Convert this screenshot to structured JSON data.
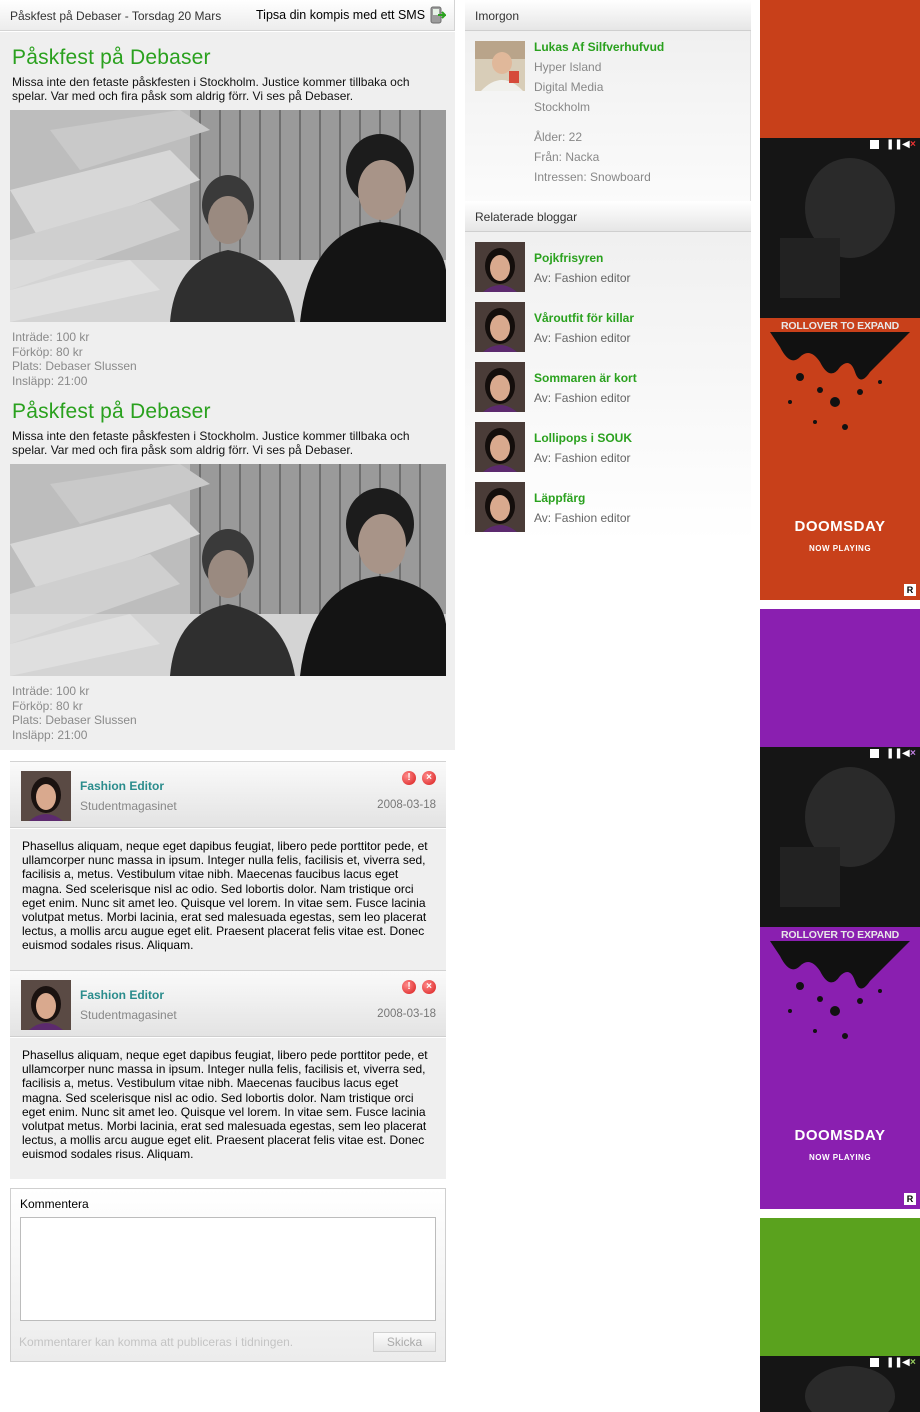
{
  "topbar": {
    "breadcrumb": "Påskfest på Debaser - Torsdag 20 Mars",
    "tip_link": "Tipsa din kompis med ett SMS",
    "tip_icon": "phone-sms-icon"
  },
  "events": [
    {
      "title": "Påskfest på Debaser",
      "description": "Missa inte den fetaste påskfesten i Stockholm. Justice kommer tillbaka och spelar. Var med och fira påsk som aldrig förr. Vi ses på Debaser.",
      "inträde": "Inträde: 100 kr",
      "förköp": "Förköp: 80 kr",
      "plats": "Plats: Debaser Slussen",
      "insläpp": "Insläpp: 21:00"
    },
    {
      "title": "Påskfest på Debaser",
      "description": "Missa inte den fetaste påskfesten i Stockholm. Justice kommer tillbaka och spelar. Var med och fira påsk som aldrig förr. Vi ses på Debaser.",
      "inträde": "Inträde: 100 kr",
      "förköp": "Förköp: 80 kr",
      "plats": "Plats: Debaser Slussen",
      "insläpp": "Insläpp: 21:00"
    }
  ],
  "comments": [
    {
      "author": "Fashion Editor",
      "org": "Studentmagasinet",
      "date": "2008-03-18",
      "body": "Phasellus aliquam, neque eget dapibus feugiat, libero pede porttitor pede, et ullamcorper nunc massa in ipsum. Integer nulla felis, facilisis et, viverra sed, facilisis a, metus. Vestibulum vitae nibh. Maecenas faucibus lacus eget magna. Sed scelerisque nisl ac odio. Sed lobortis dolor. Nam tristique orci eget enim. Nunc sit amet leo. Quisque vel lorem. In vitae sem. Fusce lacinia volutpat metus. Morbi lacinia, erat sed malesuada egestas, sem leo placerat lectus, a mollis arcu augue eget elit. Praesent placerat felis vitae est. Donec euismod sodales risus. Aliquam."
    },
    {
      "author": "Fashion Editor",
      "org": "Studentmagasinet",
      "date": "2008-03-18",
      "body": "Phasellus aliquam, neque eget dapibus feugiat, libero pede porttitor pede, et ullamcorper nunc massa in ipsum. Integer nulla felis, facilisis et, viverra sed, facilisis a, metus. Vestibulum vitae nibh. Maecenas faucibus lacus eget magna. Sed scelerisque nisl ac odio. Sed lobortis dolor. Nam tristique orci eget enim. Nunc sit amet leo. Quisque vel lorem. In vitae sem. Fusce lacinia volutpat metus. Morbi lacinia, erat sed malesuada egestas, sem leo placerat lectus, a mollis arcu augue eget elit. Praesent placerat felis vitae est. Donec euismod sodales risus. Aliquam."
    }
  ],
  "comment_form": {
    "label": "Kommentera",
    "note": "Kommentarer kan komma att publiceras i tidningen.",
    "submit": "Skicka"
  },
  "profile_section": {
    "header": "Imorgon",
    "name": "Lukas Af Silfverhufvud",
    "school": "Hyper Island",
    "program": "Digital Media",
    "city": "Stockholm",
    "age": "Ålder: 22",
    "from": "Från: Nacka",
    "interests": "Intressen: Snowboard"
  },
  "related_blogs": {
    "header": "Relaterade bloggar",
    "items": [
      {
        "title": "Pojkfrisyren",
        "by": "Av: Fashion editor"
      },
      {
        "title": "Våroutfit för killar",
        "by": "Av: Fashion editor"
      },
      {
        "title": "Sommaren är kort",
        "by": "Av: Fashion editor"
      },
      {
        "title": "Lollipops i SOUK",
        "by": "Av: Fashion editor"
      },
      {
        "title": "Läppfärg",
        "by": "Av: Fashion editor"
      }
    ]
  },
  "ads": [
    {
      "color": "#c8401a",
      "rollover": "ROLLOVER TO EXPAND",
      "brand": "DOOMSDAY",
      "tagline": "NOW PLAYING",
      "rating": "R"
    },
    {
      "color": "#8a1fb0",
      "rollover": "ROLLOVER TO EXPAND",
      "brand": "DOOMSDAY",
      "tagline": "NOW PLAYING",
      "rating": "R"
    },
    {
      "color": "#5aa21e"
    }
  ],
  "colors": {
    "green_accent": "#2aa11e",
    "teal_author": "#2a8c8c",
    "panel_grey": "#efefef"
  }
}
